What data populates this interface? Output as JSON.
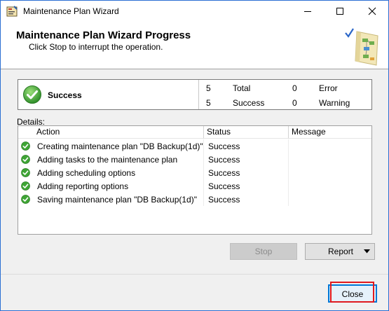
{
  "window": {
    "title": "Maintenance Plan Wizard",
    "accent_color": "#2b6fd3",
    "controls": {
      "minimize": "minimize-icon",
      "maximize": "maximize-icon",
      "close": "close-icon"
    }
  },
  "header": {
    "title": "Maintenance Plan Wizard Progress",
    "subtitle": "Click Stop to interrupt the operation."
  },
  "summary": {
    "status": "Success",
    "status_icon": "success-check-icon",
    "total_count": "5",
    "total_label": "Total",
    "success_count": "5",
    "success_label": "Success",
    "error_count": "0",
    "error_label": "Error",
    "warning_count": "0",
    "warning_label": "Warning"
  },
  "details": {
    "label": "Details:",
    "columns": [
      "Action",
      "Status",
      "Message"
    ],
    "rows": [
      {
        "action": "Creating maintenance plan \"DB Backup(1d)\"",
        "status": "Success",
        "message": ""
      },
      {
        "action": "Adding tasks to the maintenance plan",
        "status": "Success",
        "message": ""
      },
      {
        "action": "Adding scheduling options",
        "status": "Success",
        "message": ""
      },
      {
        "action": "Adding reporting options",
        "status": "Success",
        "message": ""
      },
      {
        "action": "Saving maintenance plan \"DB Backup(1d)\"",
        "status": "Success",
        "message": ""
      }
    ]
  },
  "buttons": {
    "stop": "Stop",
    "report": "Report",
    "close": "Close"
  },
  "colors": {
    "success_green": "#3fa535",
    "highlight_red": "#e0191e",
    "focus_blue": "#0078d7"
  }
}
